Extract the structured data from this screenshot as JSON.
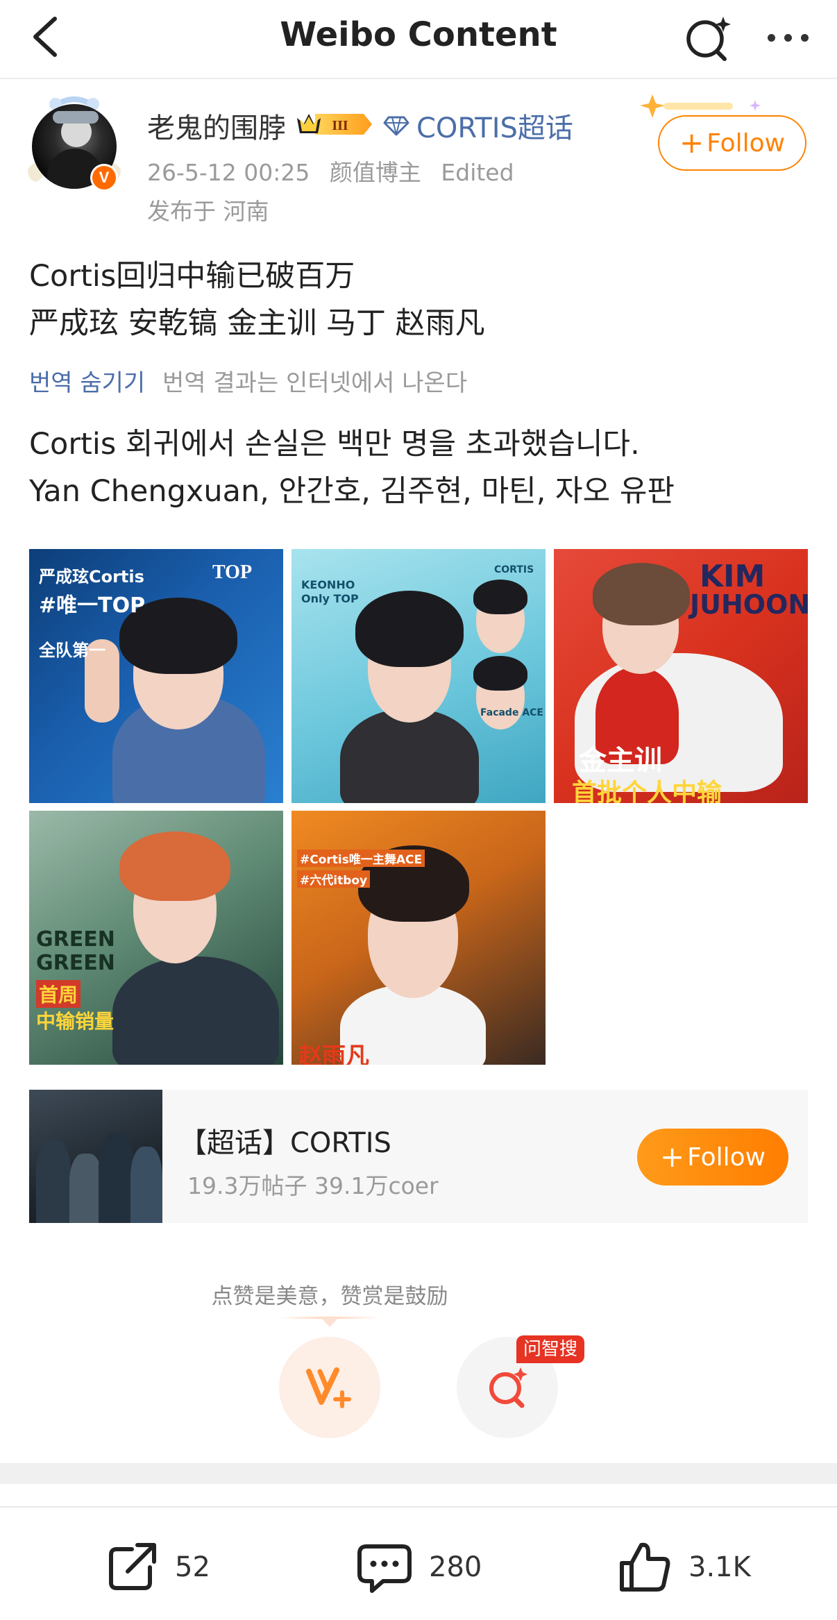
{
  "header": {
    "title": "Weibo Content",
    "back_icon": "chevron-left-icon",
    "search_icon": "ai-search-icon",
    "more_icon": "more-dots-icon"
  },
  "user": {
    "name": "老鬼的围脖",
    "vip_level": "III",
    "super_topic": "CORTIS超话",
    "time": "26-5-12 00:25",
    "tag": "颜值博主",
    "edited": "Edited",
    "location": "发布于 河南",
    "follow_label": "Follow",
    "follow_plus": "+"
  },
  "post": {
    "line1": "Cortis回归中输已破百万",
    "line2": "严成玹 安乾镐 金主训 马丁 赵雨凡",
    "translate_toggle": "번역 숨기기",
    "translate_note": "번역 결과는 인터넷에서 나온다",
    "translated_line1": "Cortis 회귀에서 손실은 백만 명을 초과했습니다.",
    "translated_line2": "Yan Chengxuan, 안간호, 김주현, 마틴, 자오 유판"
  },
  "images": {
    "t1": {
      "text_a": "严成玹Cortis",
      "text_b": "#唯一TOP",
      "text_c": "全队第一",
      "text_d": "TOP"
    },
    "t2": {
      "text_a": "KEONHO",
      "text_b": "Only TOP",
      "text_c": "CORTIS",
      "text_d": "Facade ACE"
    },
    "t3": {
      "text_a": "KIM",
      "text_b": "JUHOON",
      "text_c": "金主训",
      "text_d": "首批个人中输"
    },
    "t4": {
      "text_a": "GREEN",
      "text_b": "GREEN",
      "text_c": "首周",
      "text_d": "中输销量"
    },
    "t5": {
      "text_a": "#Cortis唯一主舞ACE",
      "text_b": "#六代itboy",
      "text_c": "赵雨凡"
    }
  },
  "topic_card": {
    "name": "【超话】CORTIS",
    "stats": "19.3万帖子 39.1万coer",
    "follow_label": "Follow",
    "follow_plus": "+"
  },
  "reward": {
    "hint": "点赞是美意，赞赏是鼓励",
    "ask_tag": "问智搜"
  },
  "actions": {
    "share_count": "52",
    "comment_count": "280",
    "like_count": "3.1K"
  },
  "colors": {
    "accent": "#ff8200",
    "link": "#4b6ea8",
    "muted": "#9a9a9a"
  }
}
